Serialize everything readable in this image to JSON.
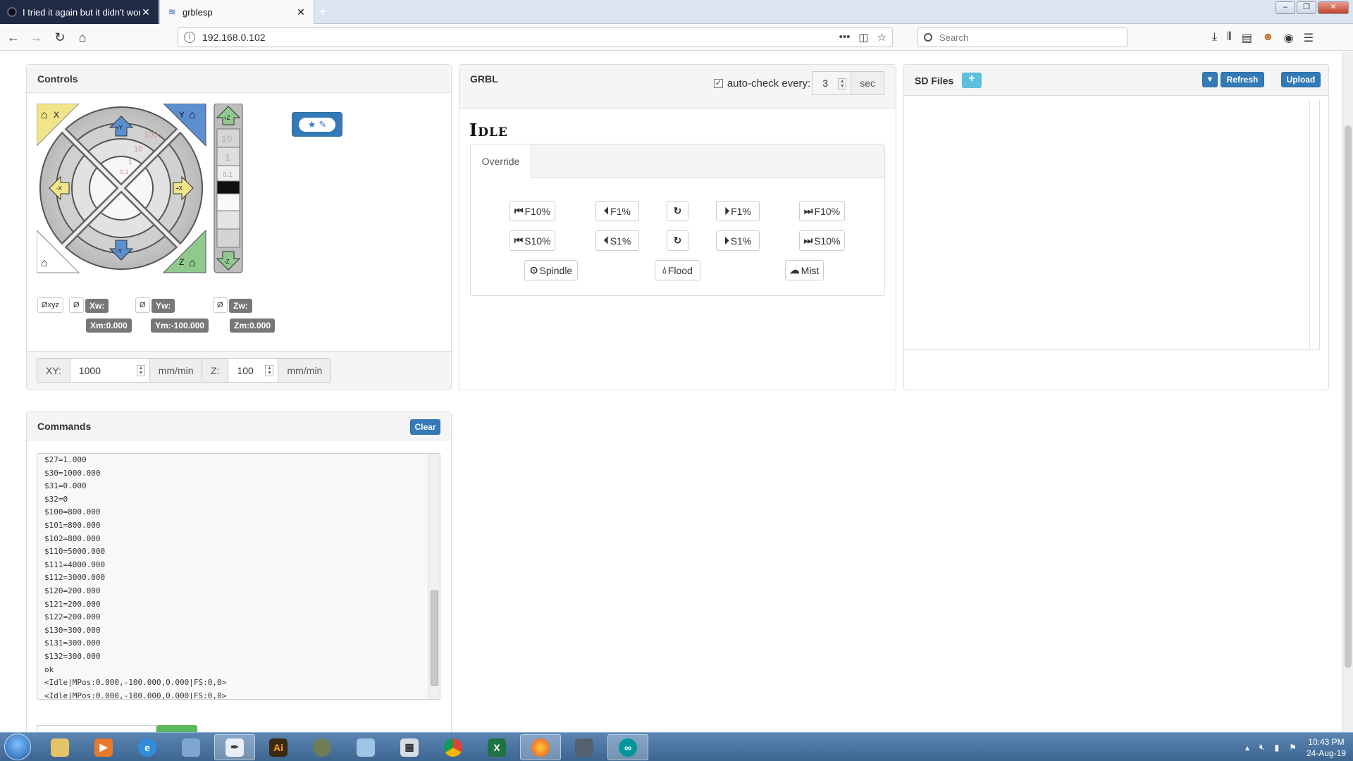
{
  "browser": {
    "tabs": [
      {
        "title": "I tried it again but it didn't worl",
        "active": false
      },
      {
        "title": "grblesp",
        "active": true
      }
    ],
    "url": "192.168.0.102",
    "search_placeholder": "Search"
  },
  "controls": {
    "title": "Controls",
    "jog": {
      "home_x_label": "X",
      "home_y_label": "Y",
      "home_z_label": "Z",
      "plus_y": "+Y",
      "minus_y": "-Y",
      "plus_x": "+X",
      "minus_x": "-X",
      "plus_z": "+Z",
      "minus_z": "-Z",
      "ring_labels": [
        "100",
        "10",
        "1",
        "0.1"
      ],
      "z_steps": [
        "10",
        "1",
        "0.1"
      ]
    },
    "zero": {
      "xyz": "Øxyz",
      "x": "Ø",
      "y": "Ø",
      "z": "Ø"
    },
    "positions": {
      "xw": "Xw:",
      "yw": "Yw:",
      "zw": "Zw:",
      "xm": "Xm:0.000",
      "ym": "Ym:-100.000",
      "zm": "Zm:0.000"
    },
    "feed": {
      "xy_label": "XY:",
      "xy_value": "1000",
      "xy_unit": "mm/min",
      "z_label": "Z:",
      "z_value": "100",
      "z_unit": "mm/min"
    }
  },
  "grbl": {
    "title": "GRBL",
    "autocheck_label": "auto-check every:",
    "autocheck_value": "3",
    "autocheck_unit": "sec",
    "state": "Idle",
    "override_tab": "Override",
    "buttons": {
      "f10_down": "F10%",
      "f1_down": "F1%",
      "f1_up": "F1%",
      "f10_up": "F10%",
      "s10_down": "S10%",
      "s1_down": "S1%",
      "s1_up": "S1%",
      "s10_up": "S10%",
      "spindle": "Spindle",
      "flood": "Flood",
      "mist": "Mist"
    }
  },
  "sd": {
    "title": "SD Files",
    "refresh": "Refresh",
    "upload": "Upload"
  },
  "commands": {
    "title": "Commands",
    "clear": "Clear",
    "lines": [
      "$27=1.000",
      "$30=1000.000",
      "$31=0.000",
      "$32=0",
      "$100=800.000",
      "$101=800.000",
      "$102=800.000",
      "$110=5000.000",
      "$111=4000.000",
      "$112=3000.000",
      "$120=200.000",
      "$121=200.000",
      "$122=200.000",
      "$130=300.000",
      "$131=300.000",
      "$132=300.000",
      "ok",
      "<Idle|MPos:0.000,-100.000,0.000|FS:0,0>",
      "<Idle|MPos:0.000,-100.000,0.000|FS:0,0>"
    ]
  },
  "taskbar": {
    "time": "10:43 PM",
    "date": "24-Aug-19"
  }
}
